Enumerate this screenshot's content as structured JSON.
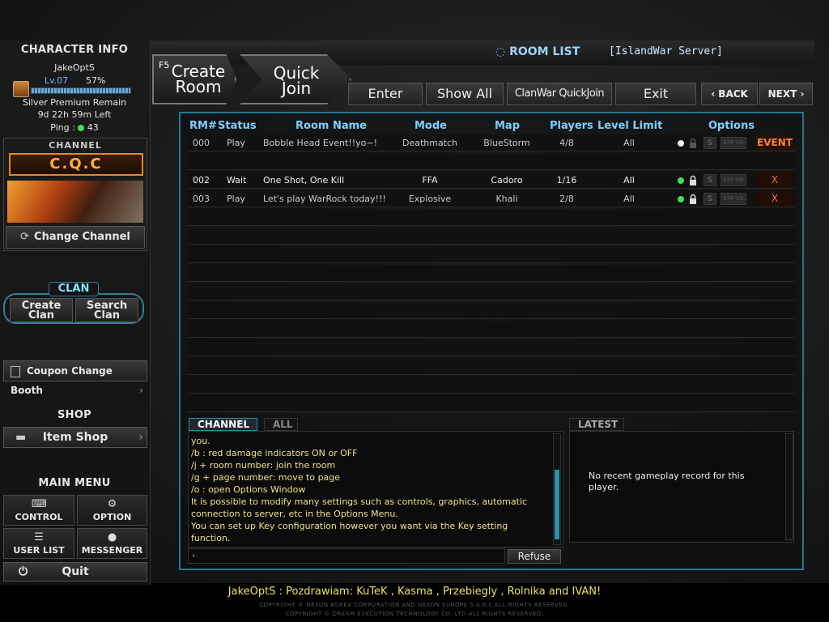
{
  "character": {
    "title": "CHARACTER INFO",
    "name": "JakeOptS",
    "level": "Lv.07",
    "xp": "57%",
    "premium": "Silver Premium Remain",
    "remain": "9d 22h 59m Left",
    "ping_label": "Ping :",
    "ping_value": "43"
  },
  "channel": {
    "title": "CHANNEL",
    "name": "C.Q.C",
    "change_label": "Change Channel"
  },
  "clan": {
    "title": "CLAN",
    "create_label": "Create Clan",
    "search_label": "Search Clan"
  },
  "coupon_label": "Coupon Change Booth",
  "shop": {
    "title": "SHOP",
    "item_shop_label": "Item Shop"
  },
  "main_menu": {
    "title": "MAIN MENU",
    "control": "CONTROL",
    "option": "OPTION",
    "user_list": "USER LIST",
    "messenger": "MESSENGER",
    "quit": "Quit"
  },
  "top": {
    "room_list": "ROOM LIST",
    "server": "[IslandWar Server]",
    "create_hotkey": "F5",
    "create_room": "Create Room",
    "quick_join": "Quick Join",
    "enter": "Enter",
    "show_all": "Show All",
    "clanwar": "ClanWar QuickJoin",
    "exit": "Exit",
    "back": "BACK",
    "next": "NEXT"
  },
  "table": {
    "headers": [
      "RM#",
      "Status",
      "Room Name",
      "Mode",
      "Map",
      "Players",
      "Level Limit",
      "Options"
    ],
    "rows": [
      {
        "rm": "000",
        "status": "Play",
        "name": "Bobble Head Event!!yo~!",
        "mode": "Deathmatch",
        "map": "BlueStorm",
        "players": "4/8",
        "level": "All",
        "tag": "EVENT"
      },
      {
        "rm": "002",
        "status": "Wait",
        "name": "One Shot, One Kill",
        "mode": "FFA",
        "map": "Cadoro",
        "players": "1/16",
        "level": "All",
        "tag": "X"
      },
      {
        "rm": "003",
        "status": "Play",
        "name": "Let's play WarRock today!!!",
        "mode": "Explosive",
        "map": "Khali",
        "players": "2/8",
        "level": "All",
        "tag": "X"
      }
    ],
    "opt_s": "S",
    "opt_exp": "EXP SN"
  },
  "chat": {
    "tab_channel": "CHANNEL",
    "tab_all": "ALL",
    "lines": [
      "you.",
      "/b : red damage indicators ON or OFF",
      "/j + room number: join the room",
      "/g + page number: move to page",
      "/o : open Options Window",
      "It is possible to modify many settings such as controls, graphics, automatic",
      "connection to server, etc in the Options Menu.",
      "You can set up Key configuration however you want via the Key setting",
      "function."
    ],
    "refuse": "Refuse"
  },
  "latest": {
    "title": "LATEST",
    "message": "No recent gameplay record for this player."
  },
  "footer": {
    "message": "JakeOptS : Pozdrawiam: KuTeK , Kasma , Przebiegly , Rolnika and IVAN!",
    "copy1": "COPYRIGHT © NEXON KOREA CORPORATION AND NEXON EUROPE S.À.R.L ALL RIGHTS RESERVED.",
    "copy2": "COPYRIGHT © DREAM EXECUTION TECHNOLOGY CO. LTD ALL RIGHTS RESERVED."
  },
  "colors": {
    "accent": "#7fd0ff",
    "event": "#ff8030",
    "chat": "#f0e08a",
    "online": "#3ee05a"
  }
}
